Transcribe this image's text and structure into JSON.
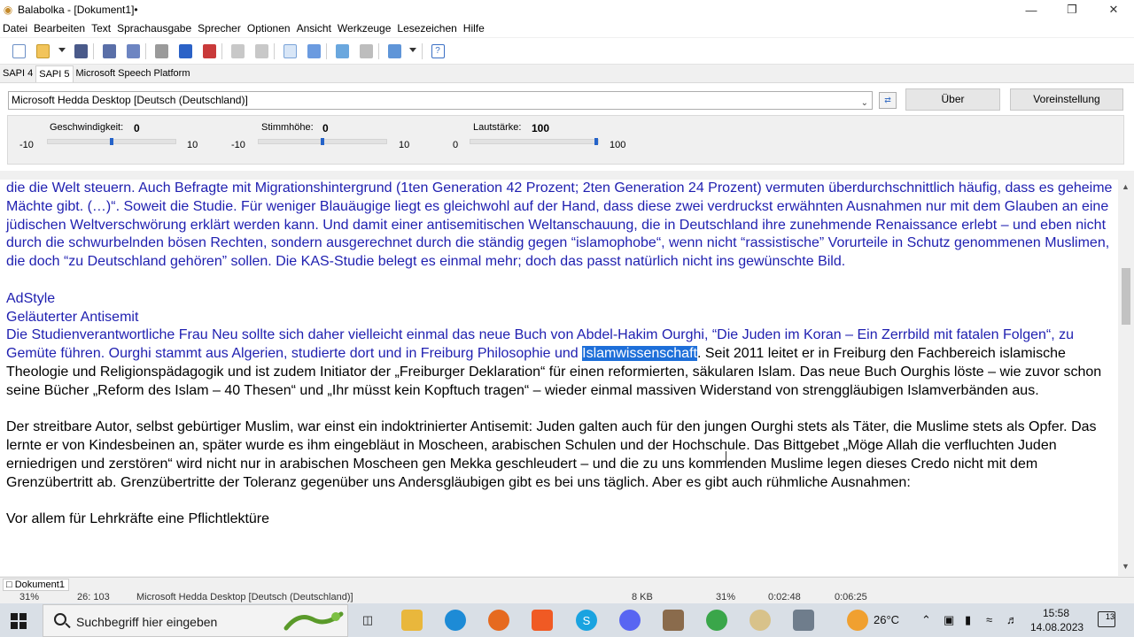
{
  "window": {
    "title": "Balabolka - [Dokument1]•"
  },
  "menu": [
    "Datei",
    "Bearbeiten",
    "Text",
    "Sprachausgabe",
    "Sprecher",
    "Optionen",
    "Ansicht",
    "Werkzeuge",
    "Lesezeichen",
    "Hilfe"
  ],
  "api_tabs": [
    "SAPI 4",
    "SAPI 5",
    "Microsoft Speech Platform"
  ],
  "voice": {
    "selected": "Microsoft Hedda Desktop [Deutsch (Deutschland)]",
    "about_button": "Über",
    "preset_button": "Voreinstellung"
  },
  "sliders": {
    "speed": {
      "label": "Geschwindigkeit:",
      "value": "0",
      "min": "-10",
      "max": "10",
      "level": 0.5
    },
    "pitch": {
      "label": "Stimmhöhe:",
      "value": "0",
      "min": "-10",
      "max": "10",
      "level": 0.5
    },
    "volume": {
      "label": "Lautstärke:",
      "value": "100",
      "min": "0",
      "max": "100",
      "level": 1.0
    }
  },
  "document": {
    "para1": "die die Welt steuern. Auch Befragte mit Migrationshintergrund (1ten Generation 42 Prozent; 2ten Generation 24 Prozent) vermuten überdurchschnittlich häufig, dass es geheime Mächte gibt. (…)“. Soweit die Studie. Für weniger Blauäugige liegt es gleichwohl auf der Hand, dass diese zwei verdruckst erwähnten Ausnahmen nur mit dem Glauben an eine jüdischen Weltverschwörung erklärt werden kann. Und damit einer antisemitischen Weltanschauung, die in Deutschland ihre zunehmende Renaissance erlebt – und eben nicht durch die schwurbelnden bösen Rechten, sondern ausgerechnet durch die ständig gegen “islamophobe“, wenn nicht “rassistische” Vorurteile in Schutz genommenen Muslimen, die doch “zu Deutschland gehören” sollen. Die KAS-Studie belegt es einmal mehr; doch das passt natürlich nicht ins gewünschte Bild.",
    "adstyle": "AdStyle",
    "heading": "Geläuterter Antisemit",
    "para2_blue": "Die Studienverantwortliche Frau Neu sollte sich daher vielleicht einmal das neue Buch von Abdel-Hakim Ourghi, “Die Juden im Koran – Ein Zerrbild mit fatalen Folgen“, zu Gemüte führen. Ourghi stammt aus Algerien, studierte dort und in Freiburg Philosophie und ",
    "para2_highlight": "Islamwissenschaft",
    "para2_rest": ". Seit 2011 leitet er in Freiburg den Fachbereich islamische Theologie und Religionspädagogik und ist zudem Initiator der „Freiburger Deklaration“ für einen reformierten, säkularen Islam. Das neue Buch Ourghis löste – wie zuvor schon seine Bücher „Reform des Islam – 40 Thesen“ und „Ihr müsst kein Kopftuch tragen“ – wieder einmal massiven Widerstand von strenggläubigen Islamverbänden aus.",
    "para3": "Der streitbare Autor, selbst gebürtiger Muslim, war einst ein indoktrinierter Antisemit: Juden galten auch für den jungen Ourghi stets als Täter, die Muslime stets als Opfer. Das lernte er von Kindesbeinen an, später wurde es ihm eingebläut in Moscheen, arabischen Schulen und der Hochschule. Das Bittgebet „Möge Allah die verfluchten Juden erniedrigen und zerstören“ wird nicht nur in arabischen Moscheen gen Mekka geschleudert – und die zu uns kommenden Muslime legen dieses Credo nicht mit dem Grenzübertritt ab. Grenzübertritte der Toleranz gegenüber uns Andersgläubigen gibt es bei uns täglich. Aber es gibt auch rühmliche Ausnahmen:",
    "para4": "Vor allem für Lehrkräfte eine Pflichtlektüre"
  },
  "doc_tab": "Dokument1",
  "status": {
    "zoom": "31%",
    "position": "26: 103",
    "voice": "Microsoft Hedda Desktop [Deutsch (Deutschland)]",
    "size": "8 KB",
    "progress": "31%",
    "elapsed": "0:02:48",
    "total": "0:06:25"
  },
  "taskbar": {
    "search_placeholder": "Suchbegriff hier eingeben",
    "weather": "26°C",
    "time": "15:58",
    "date": "14.08.2023",
    "notifications": "13"
  },
  "colors": {
    "link_blue": "#1f1fb0",
    "highlight": "#1e6fd9",
    "slider_thumb": "#2563c9"
  }
}
